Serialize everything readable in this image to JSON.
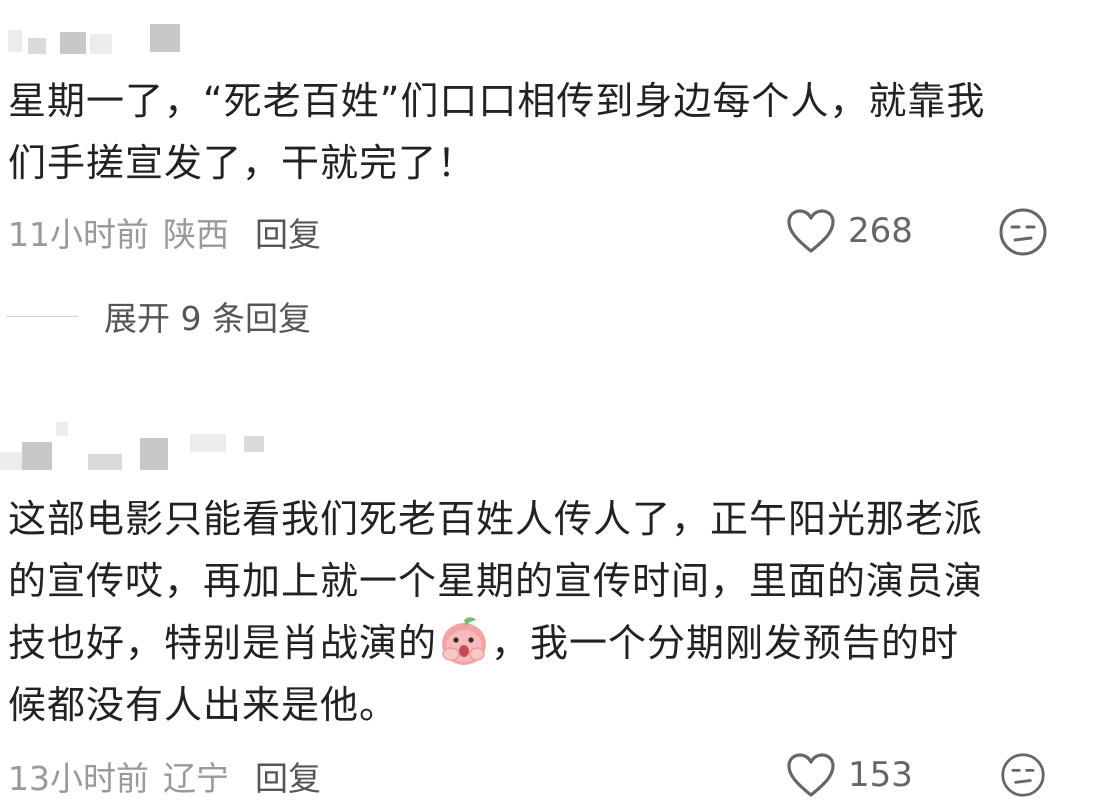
{
  "comments": [
    {
      "text_lines": [
        "星期一了，“死老百姓”们口口相传到身边每个人，就靠我",
        "们手搓宣发了，干就完了！"
      ],
      "time": "11小时前",
      "location": "陕西",
      "reply_label": "回复",
      "likes": "268",
      "expand_label": "展开 9 条回复"
    },
    {
      "text_lines": [
        "这部电影只能看我们死老百姓人传人了，正午阳光那老派",
        "的宣传哎，再加上就一个星期的宣传时间，里面的演员演",
        "技也好，特别是肖战演的",
        "，我一个分期刚发预告的时",
        "候都没有人出来是他。"
      ],
      "time": "13小时前",
      "location": "辽宁",
      "reply_label": "回复",
      "likes": "153"
    }
  ],
  "icons": {
    "like": "heart-outline-icon",
    "react": "neutral-face-icon",
    "inline_emoji": "pink-peach-emoji"
  },
  "colors": {
    "text": "#222222",
    "meta": "#999999",
    "reply": "#555555",
    "icon": "#666666"
  }
}
